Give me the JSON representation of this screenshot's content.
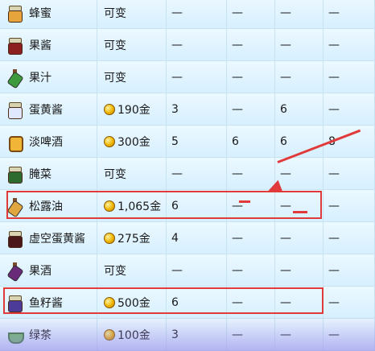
{
  "rows": [
    {
      "icon": "honey-jar-icon",
      "icon_color": "#e7a43c",
      "name": "蜂蜜",
      "price": "可变",
      "q1": "—",
      "q2": "—",
      "q3": "—",
      "q4": "—"
    },
    {
      "icon": "jelly-jar-icon",
      "icon_color": "#8c1f1f",
      "name": "果酱",
      "price": "可变",
      "q1": "—",
      "q2": "—",
      "q3": "—",
      "q4": "—"
    },
    {
      "icon": "juice-bottle-icon",
      "icon_color": "#3d9a3d",
      "name": "果汁",
      "price": "可变",
      "q1": "—",
      "q2": "—",
      "q3": "—",
      "q4": "—"
    },
    {
      "icon": "mayonnaise-jar-icon",
      "icon_color": "#dfe8ff",
      "name": "蛋黄酱",
      "price": "190金",
      "q1": "3",
      "q2": "—",
      "q3": "6",
      "q4": "—"
    },
    {
      "icon": "pale-ale-icon",
      "icon_color": "#f0b437",
      "name": "淡啤酒",
      "price": "300金",
      "q1": "5",
      "q2": "6",
      "q3": "6",
      "q4": "8"
    },
    {
      "icon": "pickles-jar-icon",
      "icon_color": "#2e6b2e",
      "name": "腌菜",
      "price": "可变",
      "q1": "—",
      "q2": "—",
      "q3": "—",
      "q4": "—"
    },
    {
      "icon": "truffle-oil-bottle-icon",
      "icon_color": "#e0a640",
      "name": "松露油",
      "price": "1,065金",
      "q1": "6",
      "q2": "—",
      "q3": "—",
      "q4": "—"
    },
    {
      "icon": "void-mayonnaise-jar-icon",
      "icon_color": "#4a1818",
      "name": "虚空蛋黄酱",
      "price": "275金",
      "q1": "4",
      "q2": "—",
      "q3": "—",
      "q4": "—"
    },
    {
      "icon": "wine-bottle-icon",
      "icon_color": "#6a2a7a",
      "name": "果酒",
      "price": "可变",
      "q1": "—",
      "q2": "—",
      "q3": "—",
      "q4": "—"
    },
    {
      "icon": "roe-jar-icon",
      "icon_color": "#4d3b9a",
      "name": "鱼籽酱",
      "price": "500金",
      "q1": "6",
      "q2": "—",
      "q3": "—",
      "q4": "—"
    },
    {
      "icon": "green-tea-icon",
      "icon_color": "#73c06b",
      "name": "绿茶",
      "price": "100金",
      "q1": "3",
      "q2": "—",
      "q3": "—",
      "q4": "—"
    }
  ],
  "annotation_color": "#e03a3a"
}
